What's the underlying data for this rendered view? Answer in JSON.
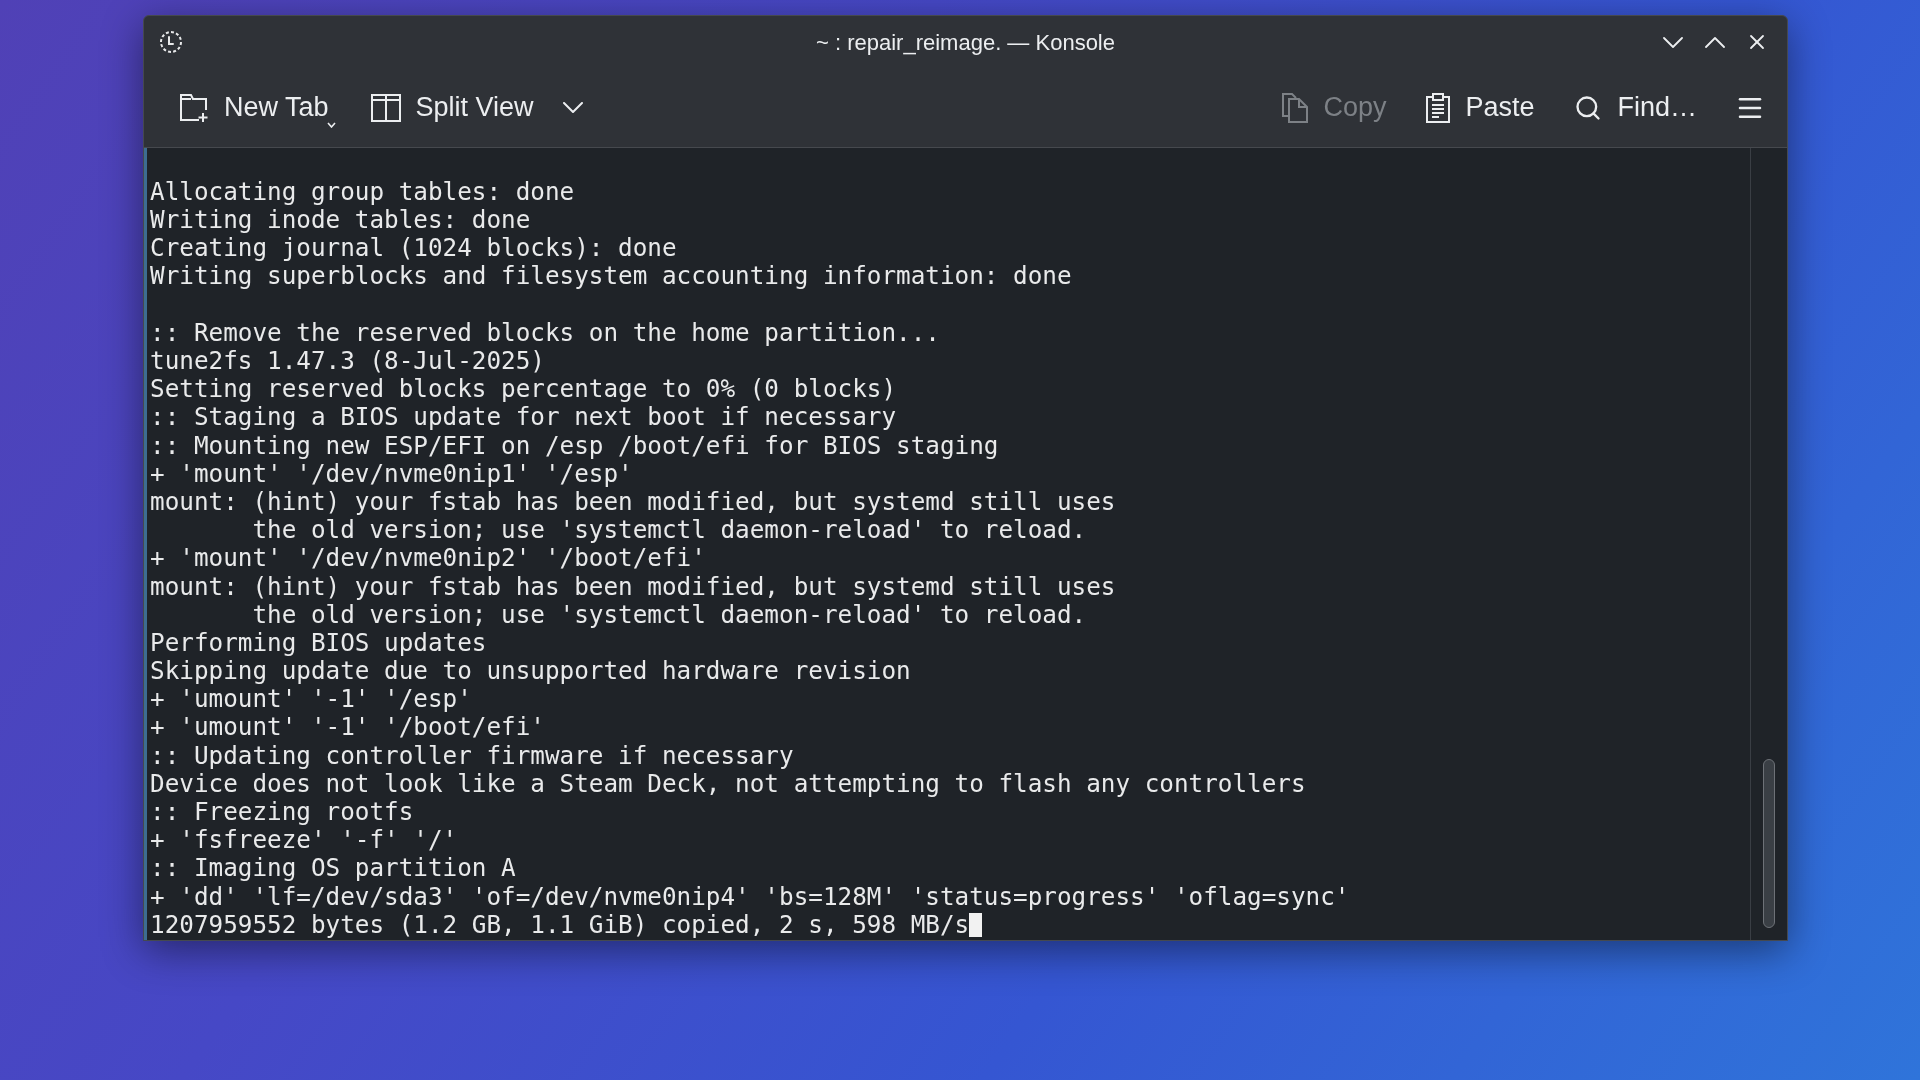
{
  "window": {
    "title": "~ : repair_reimage. — Konsole"
  },
  "toolbar": {
    "left_buttons": [
      {
        "label": "New Tab",
        "kind": "newtab",
        "disabled": false
      },
      {
        "label": "Split View",
        "kind": "split",
        "disabled": false
      }
    ],
    "right_buttons": [
      {
        "label": "Copy",
        "kind": "copy",
        "disabled": true
      },
      {
        "label": "Paste",
        "kind": "paste",
        "disabled": false
      },
      {
        "label": "Find…",
        "kind": "find",
        "disabled": false
      }
    ]
  },
  "terminal": {
    "blocks": [
      [
        "Allocating group tables: done",
        "Writing inode tables: done",
        "Creating journal (1024 blocks): done",
        "Writing superblocks and filesystem accounting information: done"
      ],
      [
        ":: Remove the reserved blocks on the home partition...",
        "tune2fs 1.47.3 (8-Jul-2025)",
        "Setting reserved blocks percentage to 0% (0 blocks)",
        ":: Staging a BIOS update for next boot if necessary",
        ":: Mounting new ESP/EFI on /esp /boot/efi for BIOS staging",
        "+ 'mount' '/dev/nvme0nip1' '/esp'",
        "mount: (hint) your fstab has been modified, but systemd still uses",
        "       the old version; use 'systemctl daemon-reload' to reload.",
        "+ 'mount' '/dev/nvme0nip2' '/boot/efi'",
        "mount: (hint) your fstab has been modified, but systemd still uses",
        "       the old version; use 'systemctl daemon-reload' to reload.",
        "Performing BIOS updates",
        "Skipping update due to unsupported hardware revision",
        "+ 'umount' '-1' '/esp'",
        "+ 'umount' '-1' '/boot/efi'",
        ":: Updating controller firmware if necessary",
        "Device does not look like a Steam Deck, not attempting to flash any controllers",
        ":: Freezing rootfs",
        "+ 'fsfreeze' '-f' '/'",
        ":: Imaging OS partition A",
        "+ 'dd' 'lf=/dev/sda3' 'of=/dev/nvme0nip4' 'bs=128M' 'status=progress' 'oflag=sync'",
        "1207959552 bytes (1.2 GB, 1.1 GiB) copied, 2 s, 598 MB/s"
      ]
    ],
    "cursor_shown": true
  }
}
